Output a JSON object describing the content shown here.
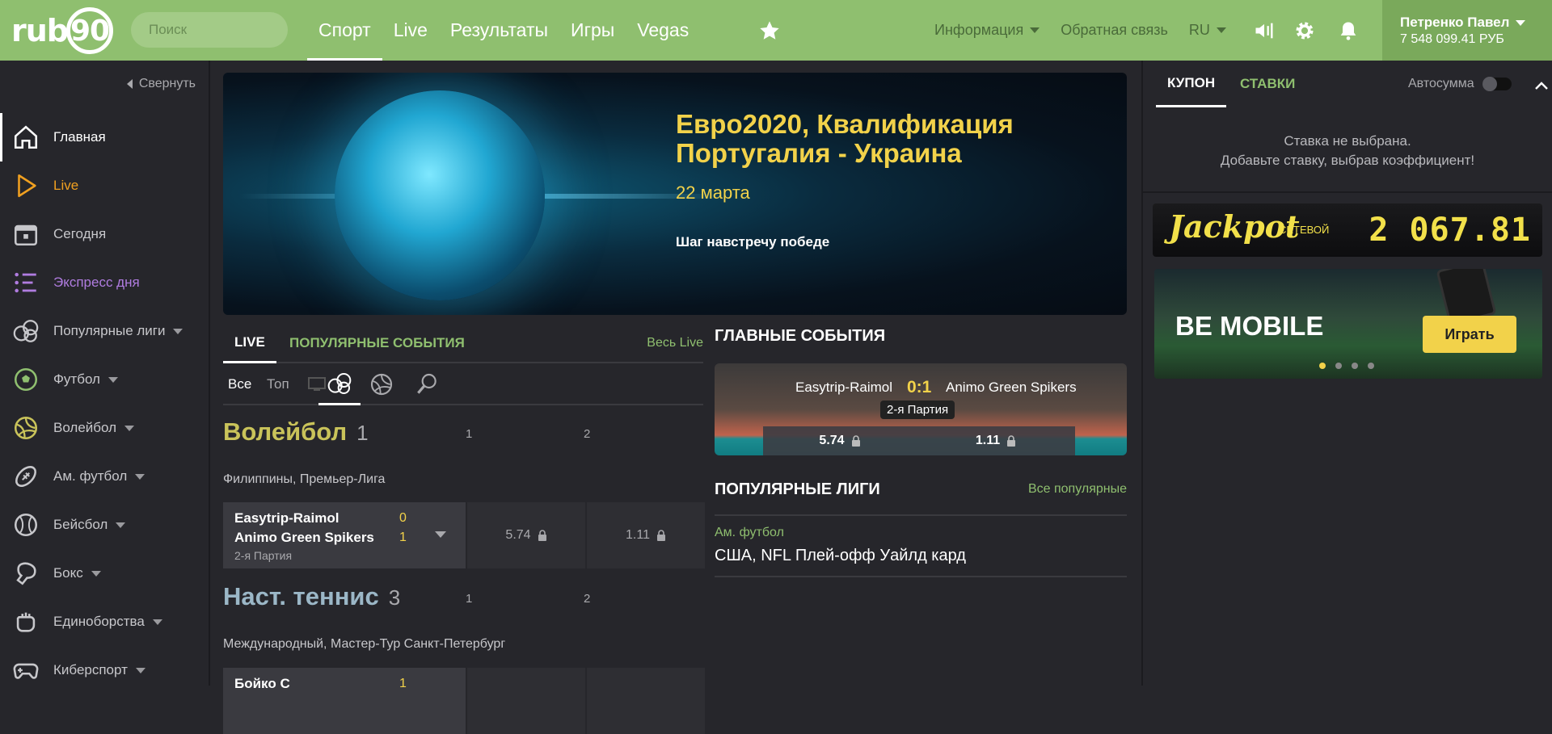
{
  "header": {
    "logo": "rub90",
    "logo_text": "rub",
    "logo_ring": "90",
    "search_placeholder": "Поиск",
    "nav": [
      "Спорт",
      "Live",
      "Результаты",
      "Игры",
      "Vegas"
    ],
    "info": "Информация",
    "feedback": "Обратная связь",
    "lang": "RU",
    "user_name": "Петренко Павел",
    "balance": "7 548 099.41 РУБ"
  },
  "sidebar": {
    "collapse": "Свернуть",
    "items": [
      {
        "label": "Главная",
        "icon": "home-icon"
      },
      {
        "label": "Live",
        "icon": "play-icon"
      },
      {
        "label": "Сегодня",
        "icon": "calendar-icon"
      },
      {
        "label": "Экспресс дня",
        "icon": "list-icon"
      },
      {
        "label": "Популярные лиги",
        "icon": "balls-icon"
      },
      {
        "label": "Футбол",
        "icon": "football-icon"
      },
      {
        "label": "Волейбол",
        "icon": "volleyball-icon"
      },
      {
        "label": "Ам. футбол",
        "icon": "american-football-icon"
      },
      {
        "label": "Бейсбол",
        "icon": "baseball-icon"
      },
      {
        "label": "Бокс",
        "icon": "boxing-icon"
      },
      {
        "label": "Единоборства",
        "icon": "fist-icon"
      },
      {
        "label": "Киберспорт",
        "icon": "gamepad-icon"
      }
    ]
  },
  "banner": {
    "title_line1": "Евро2020, Квалификация",
    "title_line2": "Португалия - Украина",
    "date": "22 марта",
    "slogan": "Шаг навстречу победе"
  },
  "live": {
    "tab_live": "LIVE",
    "tab_popular": "ПОПУЛЯРНЫЕ СОБЫТИЯ",
    "all_live": "Весь Live",
    "filter_all": "Все",
    "filter_top": "Топ",
    "col1": "1",
    "col2": "2",
    "sports": [
      {
        "name": "Волейбол",
        "count": "1",
        "league": "Филиппины, Премьер-Лига",
        "team1": "Easytrip-Raimol",
        "team2": "Animo Green Spikers",
        "score1": "0",
        "score2": "1",
        "period": "2-я Партия",
        "odd1": "5.74",
        "odd2": "1.11"
      },
      {
        "name": "Наст. теннис",
        "count": "3",
        "league": "Международный, Мастер-Тур Санкт-Петербург",
        "team1": "Бойко С",
        "score1": "1"
      }
    ]
  },
  "main_events": {
    "title": "ГЛАВНЫЕ СОБЫТИЯ",
    "team1": "Easytrip-Raimol",
    "score": "0:1",
    "team2": "Animo Green Spikers",
    "period": "2-я Партия",
    "odd1": "5.74",
    "odd2": "1.11"
  },
  "popular_leagues": {
    "title": "ПОПУЛЯРНЫЕ ЛИГИ",
    "all": "Все популярные",
    "category": "Ам. футбол",
    "league": "США, NFL Плей-офф Уайлд кард"
  },
  "coupon": {
    "tab_coupon": "КУПОН",
    "tab_bets": "СТАВКИ",
    "autosum": "Автосумма",
    "empty_line1": "Ставка не выбрана.",
    "empty_line2": "Добавьте ставку, выбрав коэффициент!",
    "jackpot_title": "Jackpot",
    "jackpot_sub": "СЕТЕВОЙ",
    "jackpot_value": "2 067.81",
    "promo_title": "BE MOBILE",
    "promo_button": "Играть"
  },
  "colors": {
    "brand": "#8fbf6f",
    "accent": "#f2d24a",
    "bg": "#26262b"
  }
}
